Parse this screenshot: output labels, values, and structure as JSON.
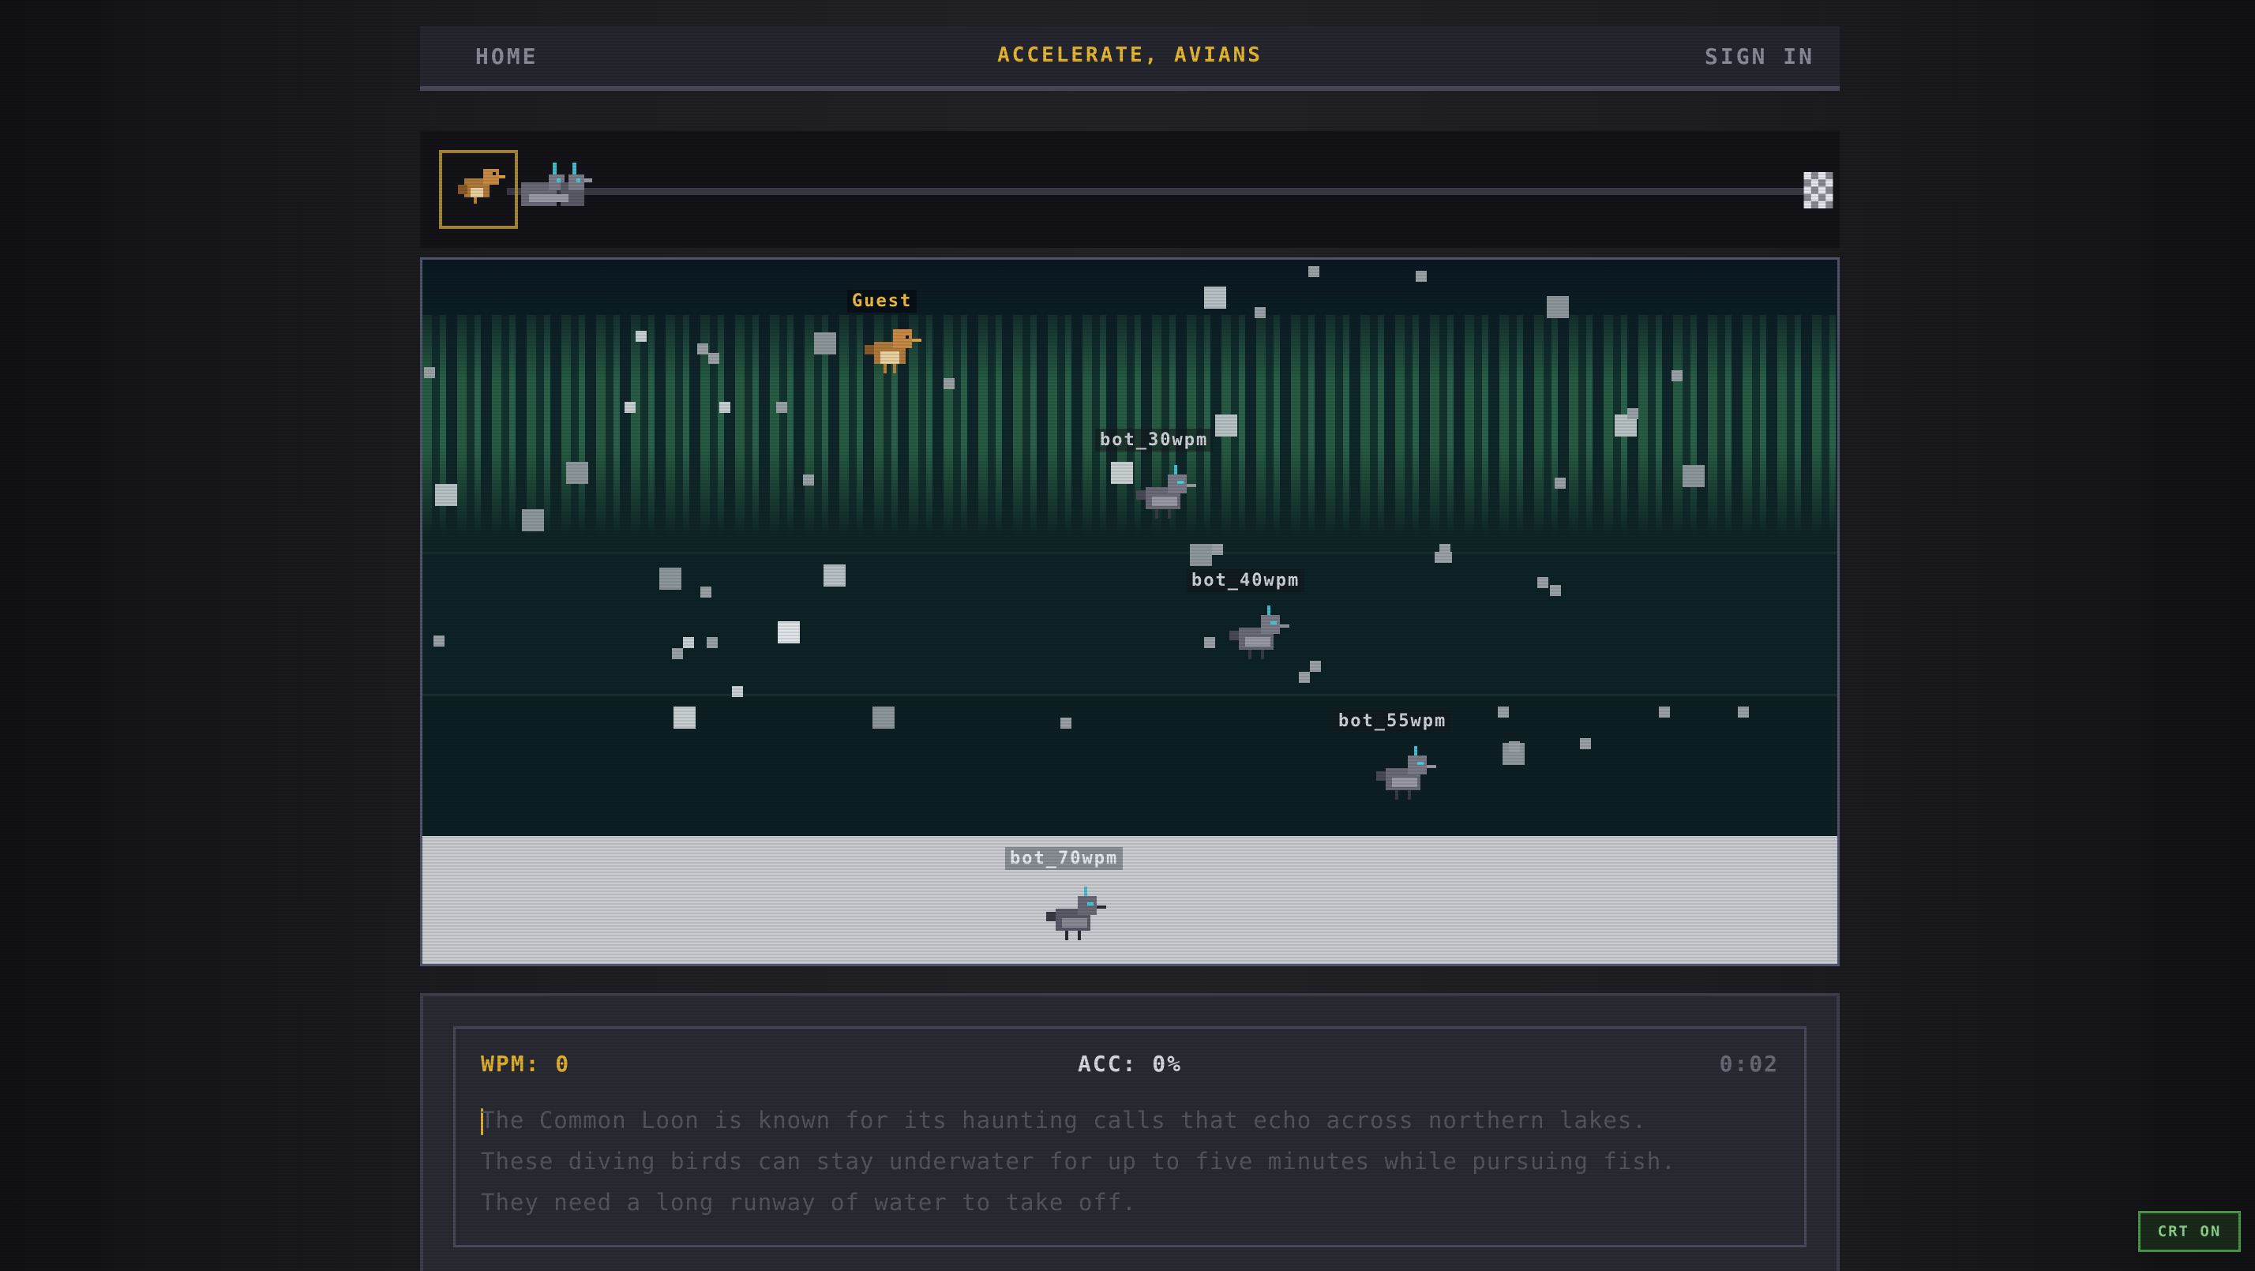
{
  "nav": {
    "home": "HOME",
    "title": "ACCELERATE, AVIANS",
    "sign_in": "SIGN IN"
  },
  "race": {
    "racers": [
      {
        "name": "Guest",
        "lane": 1
      },
      {
        "name": "bot_30wpm",
        "lane": 1
      },
      {
        "name": "bot_40wpm",
        "lane": 2
      },
      {
        "name": "bot_55wpm",
        "lane": 3
      },
      {
        "name": "bot_70wpm",
        "lane": 4
      }
    ]
  },
  "stats": {
    "wpm": "WPM: 0",
    "acc": "ACC: 0%",
    "timer": "0:02"
  },
  "passage": {
    "line1": "The Common Loon is known for its haunting calls that echo across northern lakes.",
    "line2": "These diving birds can stay underwater for up to five minutes while pursuing fish.",
    "line3": "They need a long runway of water to take off."
  },
  "crt_toggle": "CRT ON",
  "colors": {
    "accent": "#e8b830",
    "crt": "#4a9a4a"
  },
  "icons": {
    "finish": "checkered-flag-icon",
    "guest_bird": "sparrow-icon",
    "bot_bird": "pigeon-icon"
  }
}
